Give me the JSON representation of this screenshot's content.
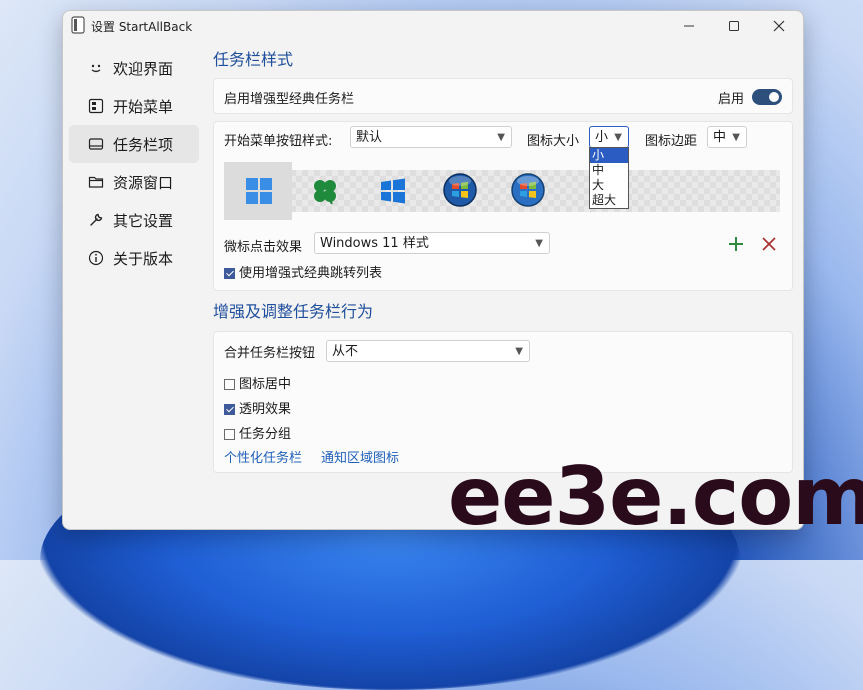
{
  "window": {
    "title": "设置 StartAllBack"
  },
  "sidebar": {
    "items": [
      {
        "label": "欢迎界面",
        "icon": "smiley-icon"
      },
      {
        "label": "开始菜单",
        "icon": "start-menu-icon"
      },
      {
        "label": "任务栏项",
        "icon": "taskbar-icon",
        "active": true
      },
      {
        "label": "资源窗口",
        "icon": "folder-icon"
      },
      {
        "label": "其它设置",
        "icon": "wrench-icon"
      },
      {
        "label": "关于版本",
        "icon": "info-icon"
      }
    ]
  },
  "taskbar_style": {
    "title": "任务栏样式",
    "enhanced_label": "启用增强型经典任务栏",
    "enable_label": "启用",
    "start_button_label": "开始菜单按钮样式:",
    "start_button_value": "默认",
    "icon_size_label": "图标大小",
    "icon_size_value": "小",
    "icon_size_options": [
      "小",
      "中",
      "大",
      "超大"
    ],
    "icon_margin_label": "图标边距",
    "icon_margin_value": "中",
    "click_effect_label": "微标点击效果",
    "click_effect_value": "Windows 11 样式",
    "jumplist_label": "使用增强式经典跳转列表",
    "jumplist_checked": true,
    "start_icons": [
      "win11-start-icon",
      "clover-start-icon",
      "win10-start-icon",
      "win7-orb-icon",
      "win7-orb-alt-icon"
    ]
  },
  "behavior": {
    "title": "增强及调整任务栏行为",
    "combine_label": "合并任务栏按钮",
    "combine_value": "从不",
    "center_label": "图标居中",
    "center_checked": false,
    "transparent_label": "透明效果",
    "transparent_checked": true,
    "group_label": "任务分组",
    "group_checked": false,
    "link_personalize": "个性化任务栏",
    "link_notify": "通知区域图标"
  },
  "watermark": "ee3e.com",
  "colors": {
    "accent": "#1f4f9c",
    "toggle": "#2d4f7c",
    "add": "#2e8b3e",
    "remove": "#a33"
  }
}
